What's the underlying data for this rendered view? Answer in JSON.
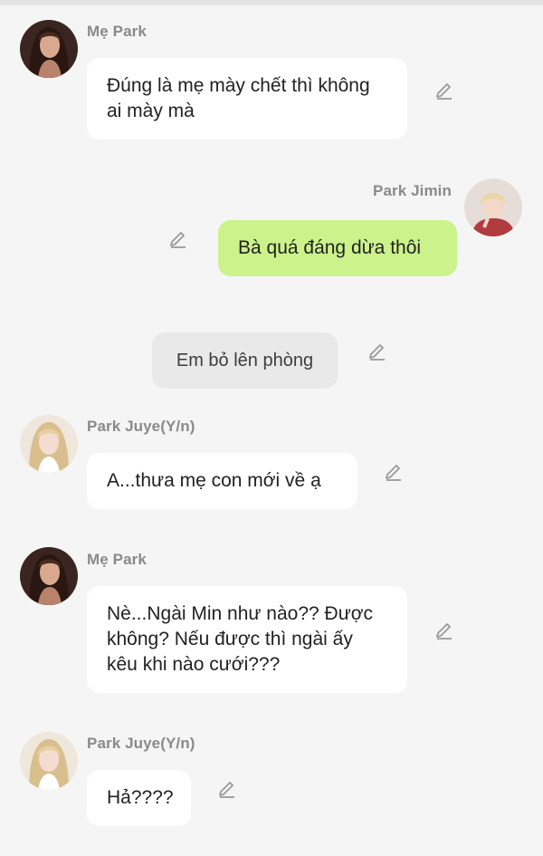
{
  "messages": [
    {
      "sender": "Mẹ Park",
      "text": "Đúng là mẹ mày chết thì không ai mày mà",
      "avatar": "woman-dark-hair-avatar"
    },
    {
      "sender": "Park Jimin",
      "text": "Bà quá đáng dừa thôi",
      "avatar": "young-man-light-hair-avatar"
    },
    {
      "sender": "",
      "text": "Em bỏ lên phòng"
    },
    {
      "sender": "Park Juye(Y/n)",
      "text": "A...thưa mẹ con mới về ạ",
      "avatar": "girl-blonde-hair-avatar"
    },
    {
      "sender": "Mẹ Park",
      "text": "Nè...Ngài Min như nào?? Được không? Nếu được thì ngài ấy kêu khi nào cưới???",
      "avatar": "woman-dark-hair-avatar"
    },
    {
      "sender": "Park Juye(Y/n)",
      "text": "Hả????",
      "avatar": "girl-blonde-hair-avatar"
    }
  ],
  "colors": {
    "background": "#f5f5f5",
    "incoming_bubble": "#ffffff",
    "outgoing_bubble": "#ccf28c",
    "narration_bubble": "#e9e9e9",
    "name_text": "#8a8a8a",
    "edit_icon": "#9a9a9a"
  },
  "icons": {
    "edit": "pencil-edit-icon"
  }
}
